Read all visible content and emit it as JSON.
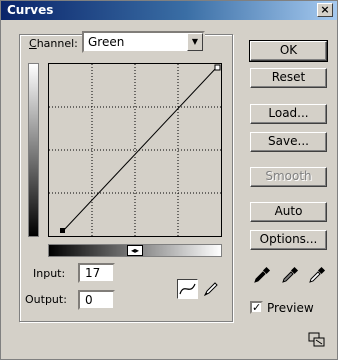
{
  "window": {
    "title": "Curves",
    "close_glyph": "×"
  },
  "channel": {
    "label": "Channel:",
    "value": "Green"
  },
  "input": {
    "label": "Input:",
    "value": "17"
  },
  "output": {
    "label": "Output:",
    "value": "0"
  },
  "buttons": {
    "ok": "OK",
    "reset": "Reset",
    "load": "Load...",
    "save": "Save...",
    "smooth": "Smooth",
    "auto": "Auto",
    "options": "Options..."
  },
  "preview": {
    "label": "Preview",
    "checked": true
  },
  "icons": [
    "close-icon",
    "dropdown-arrow-icon",
    "curve-tool-icon",
    "pencil-tool-icon",
    "black-eyedropper-icon",
    "gray-eyedropper-icon",
    "white-eyedropper-icon",
    "expand-dialog-icon"
  ]
}
